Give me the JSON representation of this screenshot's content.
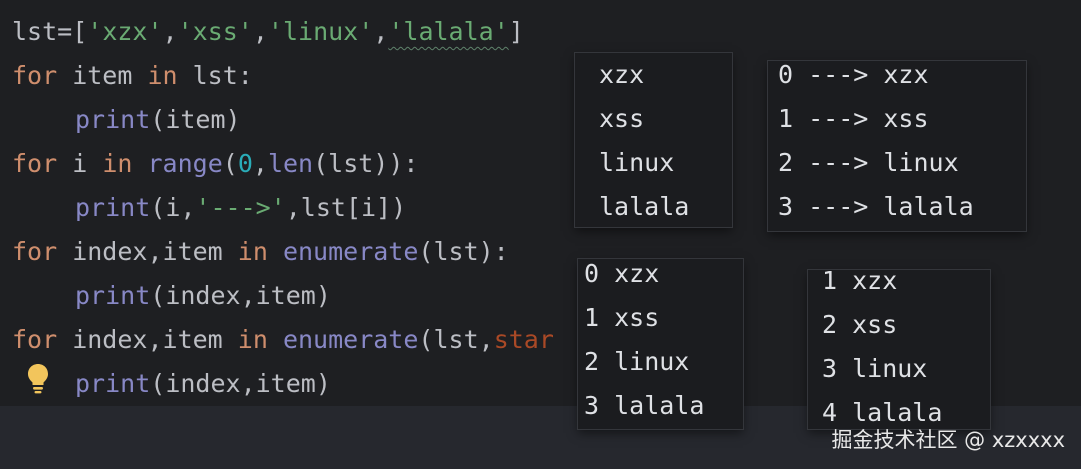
{
  "editor": {
    "lines": [
      {
        "a": "lst=[",
        "s1": "'xzx'",
        "c1": ",",
        "s2": "'xss'",
        "c2": ",",
        "s3": "'linux'",
        "c3": ",",
        "s4": "'lalala'",
        "e": "]"
      },
      {
        "kw1": "for",
        "t1": " item ",
        "kw2": "in",
        "t2": " lst:"
      },
      {
        "fn": "print",
        "t": "(item)"
      },
      {
        "kw1": "for",
        "t1": " i ",
        "kw2": "in",
        "sp": " ",
        "fn1": "range",
        "p1": "(",
        "num": "0",
        "p2": ",",
        "fn2": "len",
        "t2": "(lst)):"
      },
      {
        "fn": "print",
        "t1": "(i,",
        "str": "'--->'",
        "t2": ",lst[i])"
      },
      {
        "kw1": "for",
        "t1": " index,item ",
        "kw2": "in",
        "sp": " ",
        "fn": "enumerate",
        "t2": "(lst):"
      },
      {
        "fn": "print",
        "t": "(index,item)"
      },
      {
        "kw1": "for",
        "t1": " index,item ",
        "kw2": "in",
        "sp": " ",
        "fn": "enumerate",
        "t2": "(lst,",
        "param": "star"
      },
      {
        "fn": "print",
        "t": "(index,item)"
      }
    ]
  },
  "outputs": {
    "panel1": [
      "xzx",
      "xss",
      "linux",
      "lalala"
    ],
    "panel2": [
      "0 ---> xzx",
      "1 ---> xss",
      "2 ---> linux",
      "3 ---> lalala"
    ],
    "panel3": [
      "0 xzx",
      "1 xss",
      "2 linux",
      "3 lalala"
    ],
    "panel4": [
      "1 xzx",
      "2 xss",
      "3 linux",
      "4 lalala"
    ]
  },
  "watermark": "掘金技术社区 @ xzxxxx",
  "colors": {
    "background": "#1e1f22",
    "keyword": "#cf8e6d",
    "builtin": "#8888c6",
    "string": "#6aab73",
    "number": "#2aacb8",
    "param": "#aa4926"
  },
  "icons": {
    "gutter": "lightbulb-icon"
  }
}
